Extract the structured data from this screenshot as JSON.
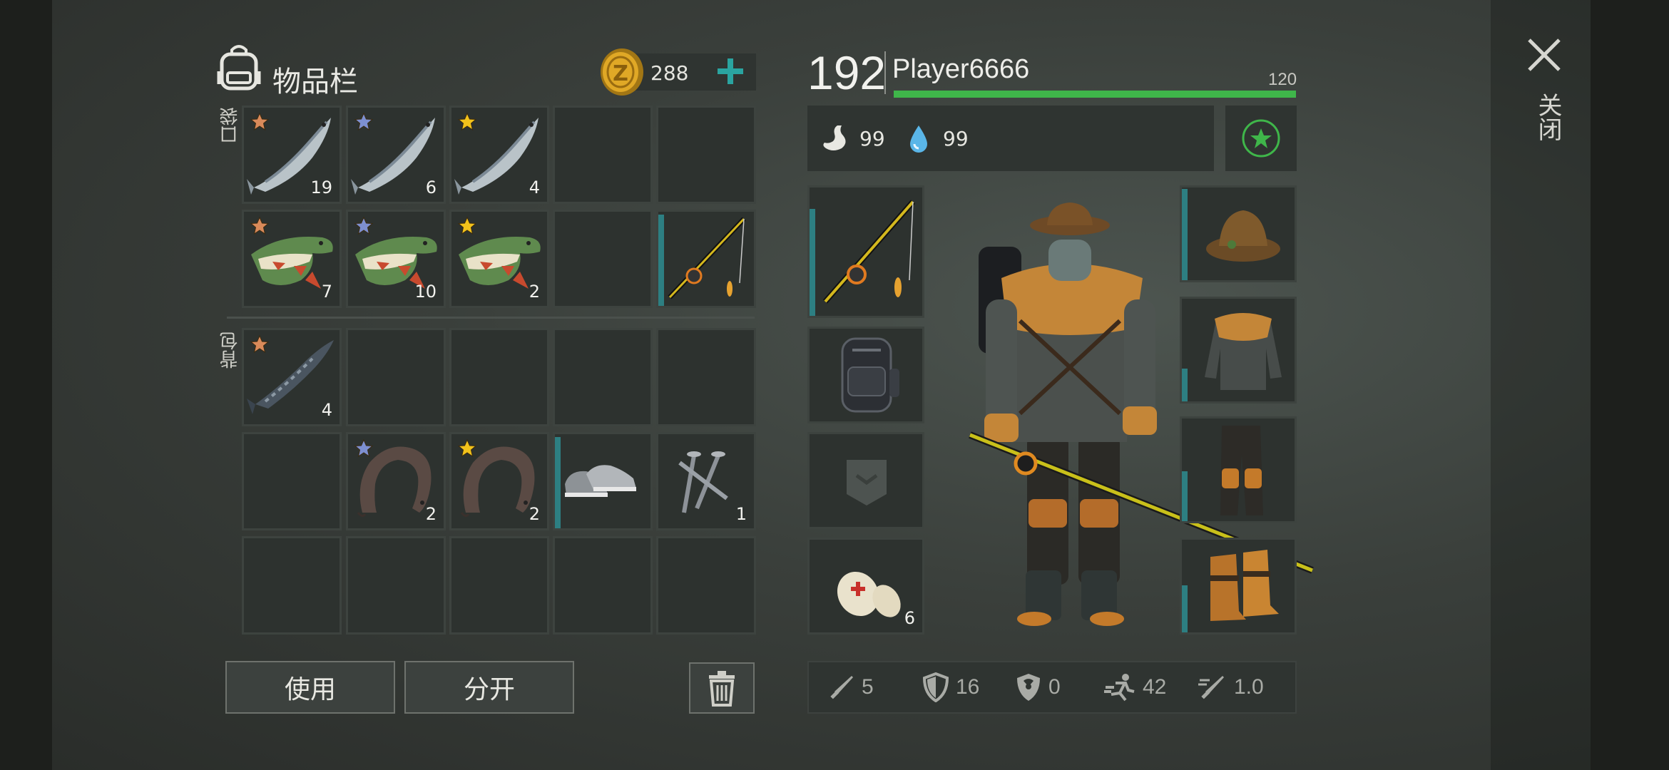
{
  "inventory": {
    "title": "物品栏",
    "pocket_label": "口袋",
    "backpack_label": "背包",
    "coins": "288",
    "buttons": {
      "use": "使用",
      "split": "分开"
    }
  },
  "player": {
    "level": "192",
    "name": "Player6666",
    "xp_value": "120",
    "xp_fraction": 1.0,
    "hunger": "99",
    "thirst": "99"
  },
  "slots": {
    "pocket": [
      {
        "item": "salmon",
        "star": "bronze",
        "count": "19"
      },
      {
        "item": "salmon",
        "star": "silver",
        "count": "6"
      },
      {
        "item": "salmon",
        "star": "gold",
        "count": "4"
      },
      {
        "item": "empty",
        "star": "",
        "count": ""
      },
      {
        "item": "empty",
        "star": "",
        "count": ""
      },
      {
        "item": "pike",
        "star": "bronze",
        "count": "7"
      },
      {
        "item": "pike",
        "star": "silver",
        "count": "10"
      },
      {
        "item": "pike",
        "star": "gold",
        "count": "2"
      },
      {
        "item": "empty",
        "star": "",
        "count": ""
      },
      {
        "item": "fishing-rod",
        "star": "",
        "count": ""
      }
    ],
    "backpack": [
      {
        "item": "sturgeon",
        "star": "bronze",
        "count": "4"
      },
      {
        "item": "catfish",
        "star": "silver",
        "count": "2"
      },
      {
        "item": "catfish",
        "star": "gold",
        "count": "2"
      },
      {
        "item": "sneakers",
        "star": "",
        "count": ""
      },
      {
        "item": "nails",
        "star": "",
        "count": "1"
      }
    ],
    "bandage_count": "6"
  },
  "stats": {
    "attack": "5",
    "armor": "16",
    "radiation": "0",
    "speed": "42",
    "attack_speed": "1.0"
  },
  "close": {
    "label": "关闭"
  },
  "colors": {
    "star_bronze": "#d98a5a",
    "star_silver": "#7d8fd0",
    "star_gold": "#f2c21b",
    "xp_bar": "#3fb64a",
    "accent_teal": "#2aa4a0"
  }
}
